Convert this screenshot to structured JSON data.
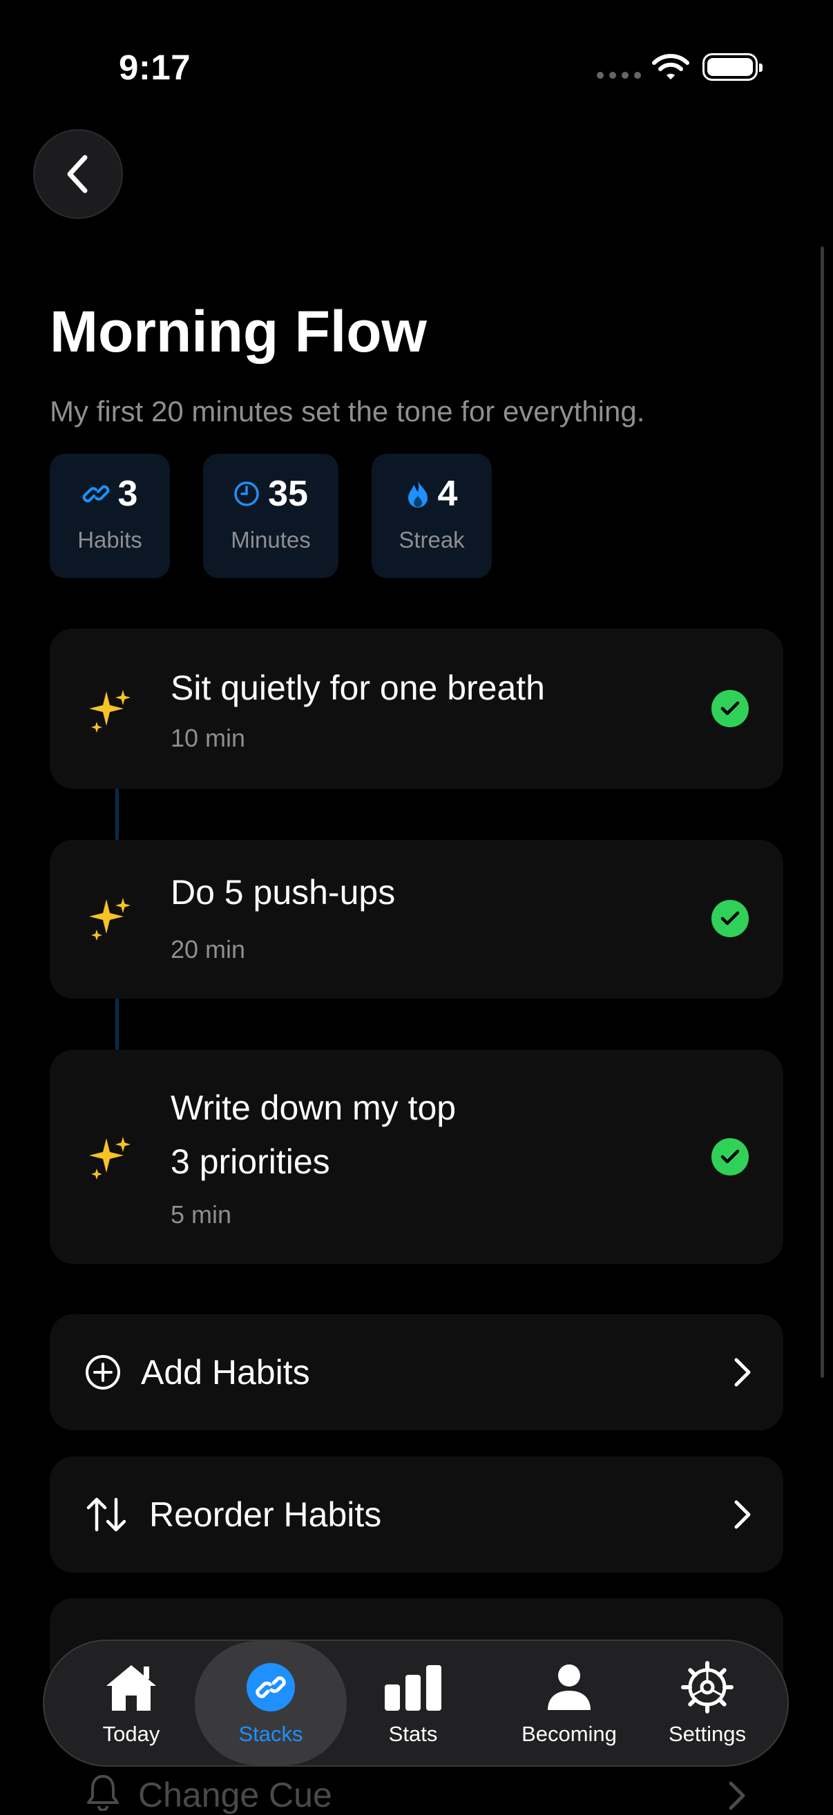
{
  "status_bar": {
    "time": "9:17"
  },
  "stack": {
    "title": "Morning Flow",
    "subtitle": "My first 20 minutes set the tone for everything."
  },
  "stats": [
    {
      "value": "3",
      "label": "Habits",
      "icon": "link-icon"
    },
    {
      "value": "35",
      "label": "Minutes",
      "icon": "clock-icon"
    },
    {
      "value": "4",
      "label": "Streak",
      "icon": "flame-icon"
    }
  ],
  "habits": [
    {
      "name": "Sit quietly for one breath",
      "duration": "10 min",
      "completed": true,
      "emoji": "✨"
    },
    {
      "name": "Do 5 push-ups",
      "duration": "20 min",
      "completed": true,
      "emoji": "✨"
    },
    {
      "name_line1": "Write down my top",
      "name_line2": "3 priorities",
      "duration": "5 min",
      "completed": true,
      "emoji": "✨"
    }
  ],
  "actions": {
    "add_habits": "Add Habits",
    "reorder_habits": "Reorder Habits",
    "change_cue": "Change Cue"
  },
  "tabs": [
    {
      "label": "Today",
      "icon": "house-icon"
    },
    {
      "label": "Stacks",
      "icon": "link-icon",
      "active": true
    },
    {
      "label": "Stats",
      "icon": "bar-chart-icon"
    },
    {
      "label": "Becoming",
      "icon": "person-icon"
    },
    {
      "label": "Settings",
      "icon": "gear-icon"
    }
  ],
  "colors": {
    "accent": "#1e90ff",
    "success": "#30d158",
    "background": "#000000"
  }
}
